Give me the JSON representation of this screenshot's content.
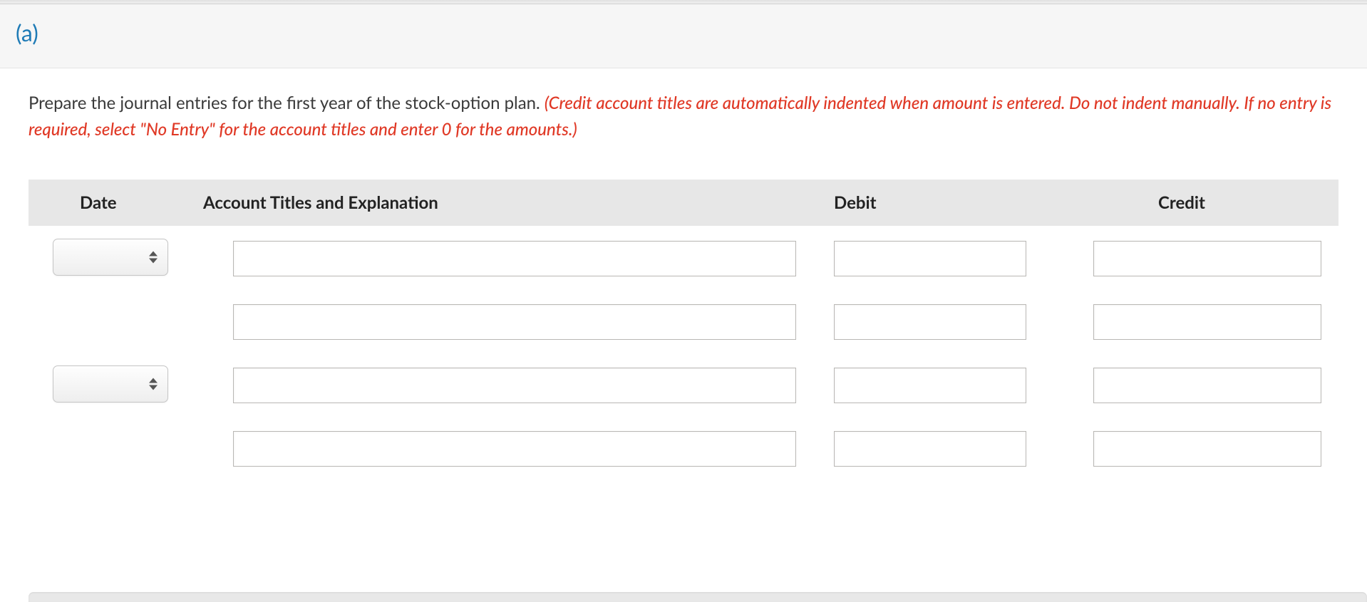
{
  "part_label": "(a)",
  "instruction_plain": "Prepare the journal entries for the first year of the stock-option plan. ",
  "instruction_hint": "(Credit account titles are automatically indented when amount is entered. Do not indent manually. If no entry is required, select \"No Entry\" for the account titles and enter 0 for the amounts.)",
  "table": {
    "headers": {
      "date": "Date",
      "account": "Account Titles and Explanation",
      "debit": "Debit",
      "credit": "Credit"
    },
    "rows": [
      {
        "date": "",
        "account": "",
        "debit": "",
        "credit": ""
      },
      {
        "date": null,
        "account": "",
        "debit": "",
        "credit": ""
      },
      {
        "date": "",
        "account": "",
        "debit": "",
        "credit": ""
      },
      {
        "date": null,
        "account": "",
        "debit": "",
        "credit": ""
      }
    ]
  }
}
